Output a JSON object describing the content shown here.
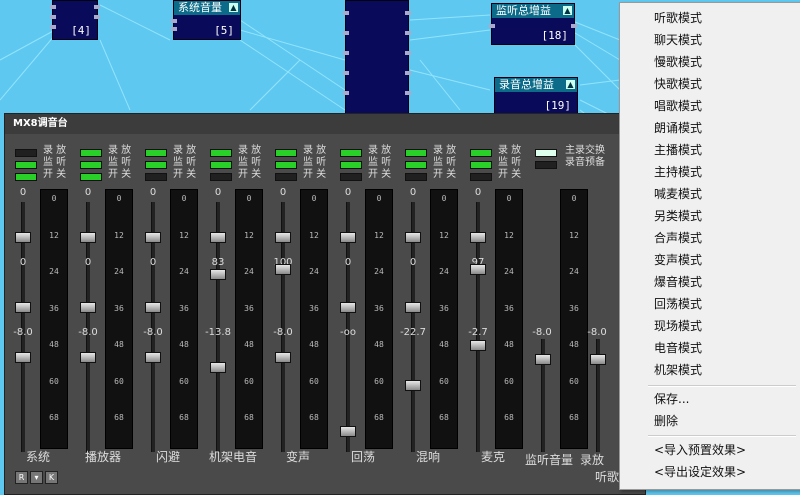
{
  "nodes": [
    {
      "title": "",
      "num": "[4]"
    },
    {
      "title": "系统音量",
      "num": "[5]"
    },
    {
      "title": "",
      "num": ""
    },
    {
      "title": "监听总增益",
      "num": "[18]"
    },
    {
      "title": "录音总增益",
      "num": "[19]"
    }
  ],
  "mixer": {
    "title": "MX8调音台",
    "bottom_buttons": [
      "R",
      "▾",
      "K"
    ],
    "right_buttons": [
      "主录交换",
      "录音预备"
    ],
    "button_labels": [
      "录 放",
      "监 听",
      "开 关"
    ],
    "channels": [
      {
        "name": "系统",
        "vals": [
          "0",
          "0",
          "-8.0"
        ],
        "meter_ticks": [
          "0",
          "12",
          "24",
          "36",
          "48",
          "60",
          "68"
        ]
      },
      {
        "name": "播放器",
        "vals": [
          "0",
          "0",
          "-8.0"
        ],
        "meter_ticks": [
          "0",
          "12",
          "24",
          "36",
          "48",
          "60",
          "68"
        ]
      },
      {
        "name": "闪避",
        "vals": [
          "0",
          "0",
          "-8.0"
        ],
        "meter_ticks": [
          "0",
          "12",
          "24",
          "36",
          "48",
          "60",
          "68"
        ]
      },
      {
        "name": "机架电音",
        "vals": [
          "0",
          "83",
          "-13.8"
        ],
        "meter_ticks": [
          "0",
          "12",
          "24",
          "36",
          "48",
          "60",
          "68"
        ]
      },
      {
        "name": "变声",
        "vals": [
          "0",
          "100",
          "-8.0"
        ],
        "meter_ticks": [
          "0",
          "12",
          "24",
          "36",
          "48",
          "60",
          "68"
        ]
      },
      {
        "name": "回荡",
        "vals": [
          "0",
          "0",
          "-oo"
        ],
        "meter_ticks": [
          "0",
          "12",
          "24",
          "36",
          "48",
          "60",
          "68"
        ]
      },
      {
        "name": "混响",
        "vals": [
          "0",
          "0",
          "-22.7"
        ],
        "meter_ticks": [
          "0",
          "12",
          "24",
          "36",
          "48",
          "60",
          "68"
        ]
      },
      {
        "name": "麦克",
        "vals": [
          "0",
          "97",
          "-2.7"
        ],
        "meter_ticks": [
          "0",
          "12",
          "24",
          "36",
          "48",
          "60",
          "68"
        ]
      }
    ],
    "masters": [
      {
        "name": "监听音量",
        "val": "-8.0",
        "meter_ticks": [
          "0",
          "12",
          "24",
          "36",
          "48",
          "60",
          "68"
        ]
      },
      {
        "name": "录放",
        "val": "-8.0"
      }
    ],
    "footer_text": "听歌"
  },
  "menu": {
    "modes": [
      "听歌模式",
      "聊天模式",
      "慢歌模式",
      "快歌模式",
      "唱歌模式",
      "朗诵模式",
      "主播模式",
      "主持模式",
      "喊麦模式",
      "另类模式",
      "合声模式",
      "变声模式",
      "爆音模式",
      "回荡模式",
      "现场模式",
      "电音模式",
      "机架模式"
    ],
    "save": "保存...",
    "delete": "删除",
    "import": "<导入预置效果>",
    "export": "<导出设定效果>"
  }
}
